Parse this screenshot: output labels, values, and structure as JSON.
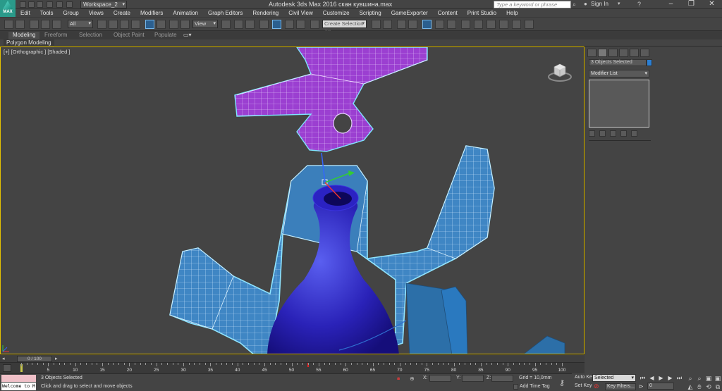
{
  "app": {
    "logo_text": "MAX",
    "title": "Autodesk 3ds Max 2016     скан кувшина.max",
    "workspace": "Workspace_2",
    "search_placeholder": "Type a keyword or phrase",
    "signin": "Sign In"
  },
  "menu": [
    "Edit",
    "Tools",
    "Group",
    "Views",
    "Create",
    "Modifiers",
    "Animation",
    "Graph Editors",
    "Rendering",
    "Civil View",
    "Customize",
    "Scripting",
    "GameExporter",
    "Content",
    "Print Studio",
    "Help"
  ],
  "toolbar": {
    "selection_filter": "All",
    "ref_coord": "View",
    "named_selection": "Create Selection Se"
  },
  "ribbon": {
    "tabs": [
      "Modeling",
      "Freeform",
      "Selection",
      "Object Paint",
      "Populate"
    ],
    "active_tab": "Modeling",
    "panel_label": "Polygon Modeling"
  },
  "viewport": {
    "label": "[+] [Orthographic ] [Shaded ]",
    "border_color": "#e5c200"
  },
  "command_panel": {
    "object_selection": "3 Objects Selected",
    "object_color": "#2a7fd4",
    "modifier_list": "Modifier List"
  },
  "timeline": {
    "slider_label": "0 / 100",
    "current_frame": 53,
    "ticks": [
      5,
      10,
      15,
      20,
      25,
      30,
      35,
      40,
      45,
      50,
      55,
      60,
      65,
      70,
      75,
      80,
      85,
      90,
      95,
      100
    ]
  },
  "status": {
    "maxscript_text": "Welcome to M",
    "selection": "3 Objects Selected",
    "prompt": "Click and drag to select and move objects",
    "x_label": "X:",
    "y_label": "Y:",
    "z_label": "Z:",
    "grid": "Grid = 10,0mm",
    "add_time_tag": "Add Time Tag"
  },
  "animation": {
    "auto_key": "Auto Key",
    "set_key": "Set Key",
    "selected": "Selected",
    "key_filters": "Key Filters...",
    "frame": "0"
  }
}
